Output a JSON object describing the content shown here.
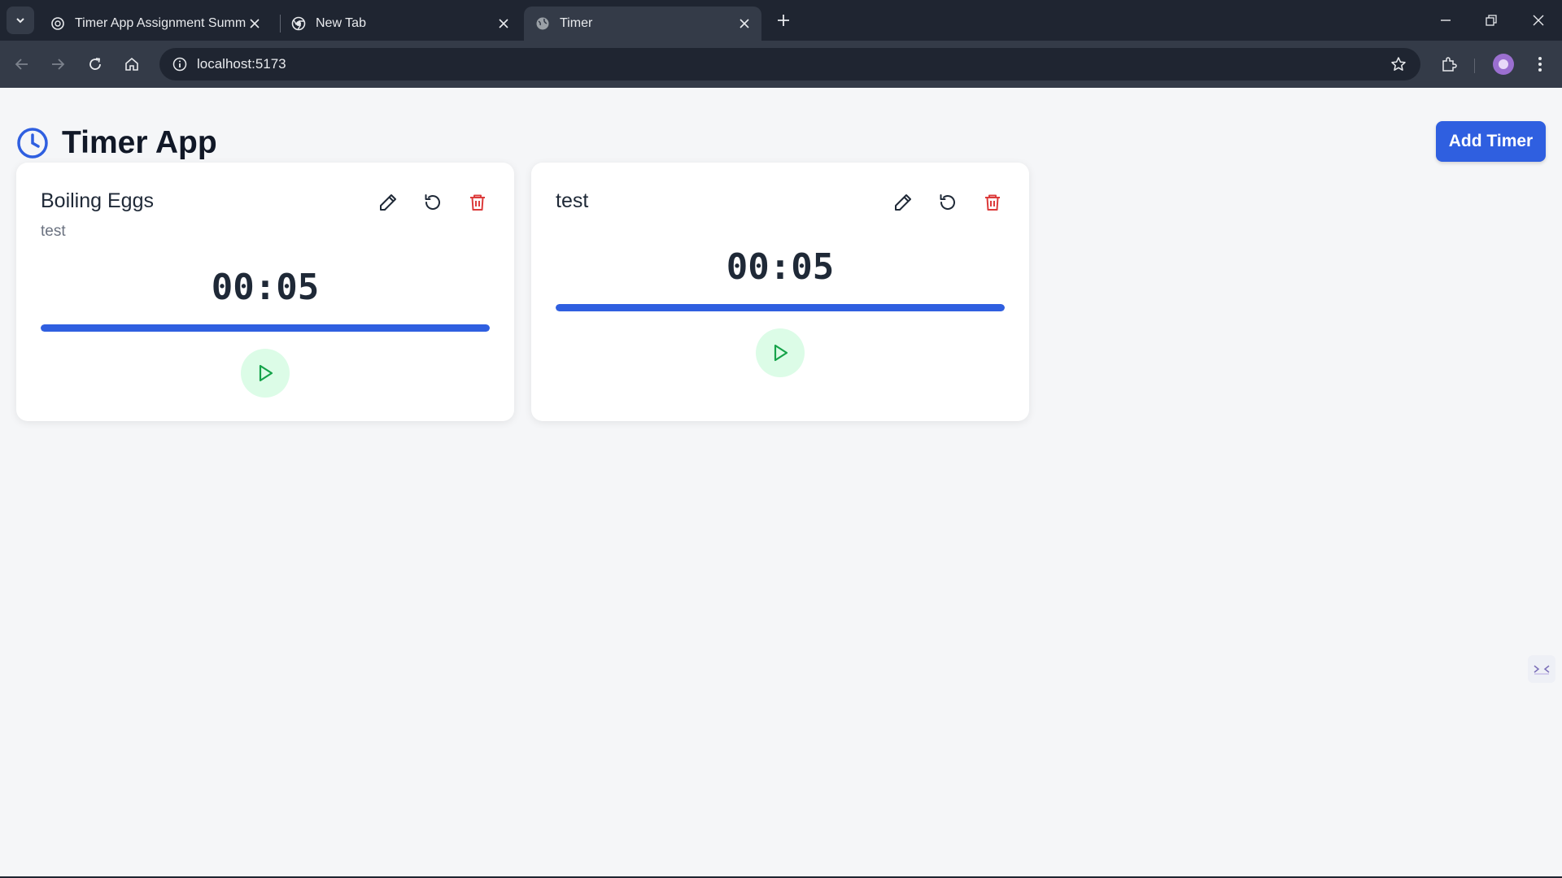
{
  "browser": {
    "tabs": [
      {
        "title": "Timer App Assignment Summar",
        "active": false,
        "icon": "openai-icon"
      },
      {
        "title": "New Tab",
        "active": false,
        "icon": "chrome-icon"
      },
      {
        "title": "Timer",
        "active": true,
        "icon": "globe-icon"
      }
    ],
    "url": "localhost:5173"
  },
  "app": {
    "title": "Timer App",
    "add_timer_label": "Add Timer",
    "accent_color": "#2f5fe0",
    "delete_color": "#dc3b3b",
    "play_color": "#16a34a"
  },
  "timers": [
    {
      "name": "Boiling Eggs",
      "description": "test",
      "time": "00:05",
      "progress": 1.0
    },
    {
      "name": "test",
      "description": "",
      "time": "00:05",
      "progress": 1.0
    }
  ]
}
